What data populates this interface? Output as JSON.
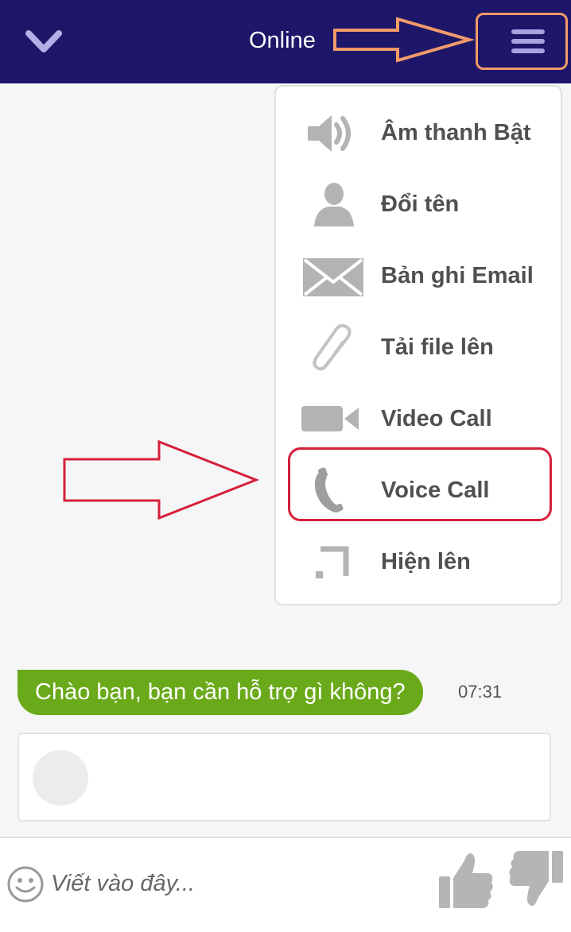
{
  "header": {
    "status_title": "Online",
    "collapse_icon": "chevron-down-icon",
    "menu_icon": "hamburger-icon"
  },
  "menu": {
    "items": [
      {
        "label": "Âm thanh Bật",
        "icon": "speaker-icon"
      },
      {
        "label": "Đổi tên",
        "icon": "user-icon"
      },
      {
        "label": "Bản ghi Email",
        "icon": "envelope-icon"
      },
      {
        "label": "Tải file lên",
        "icon": "paperclip-icon"
      },
      {
        "label": "Video Call",
        "icon": "video-camera-icon"
      },
      {
        "label": "Voice Call",
        "icon": "phone-icon"
      },
      {
        "label": "Hiện lên",
        "icon": "popout-icon"
      }
    ],
    "highlighted_item": "Voice Call"
  },
  "chat": {
    "message": "Chào bạn, bạn cần hỗ trợ gì không?",
    "timestamp": "07:31"
  },
  "input": {
    "placeholder": "Viết vào đây..."
  },
  "colors": {
    "header_bg": "#1e1668",
    "bubble_bg": "#6aaa1a",
    "annotation_orange": "#f39a6a",
    "annotation_red": "#d6203a"
  }
}
